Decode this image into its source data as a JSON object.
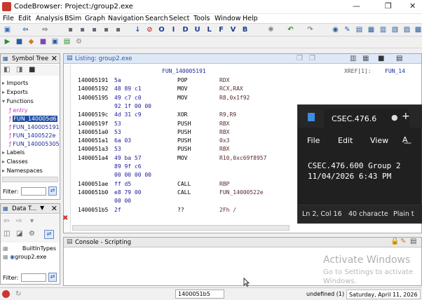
{
  "window": {
    "title": "CodeBrowser: Project:/group2.exe"
  },
  "menubar": [
    "File",
    "Edit",
    "Analysis",
    "BSim",
    "Graph",
    "Navigation",
    "Search",
    "Select",
    "Tools",
    "Window",
    "Help"
  ],
  "symbol_tree": {
    "title": "Symbol Tree",
    "items": [
      "Imports",
      "Exports",
      "Functions",
      "entry",
      "FUN_140005d6",
      "FUN_140005191",
      "FUN_1400522e",
      "FUN_140005305",
      "Labels",
      "Classes",
      "Namespaces"
    ],
    "filter_label": "Filter:"
  },
  "data_types": {
    "title": "Data T...",
    "items": [
      "BuiltInTypes",
      "group2.exe"
    ],
    "filter_label": "Filter:"
  },
  "listing": {
    "tab_title": "Listing:  group2.exe",
    "function_label": "FUN_140005191",
    "xref_label": "XREF[1]:",
    "xref_target": "FUN_14",
    "rows": [
      {
        "addr": "140005191",
        "bytes": "5a",
        "mnemonic": "POP",
        "operand": "RDX"
      },
      {
        "addr": "140005192",
        "bytes": "48 89 c1",
        "mnemonic": "MOV",
        "operand": "RCX,RAX"
      },
      {
        "addr": "140005195",
        "bytes": "49 c7 c0",
        "mnemonic": "MOV",
        "operand": "R8,0x1f92"
      },
      {
        "addr": "",
        "bytes": "92 1f 00 00",
        "mnemonic": "",
        "operand": ""
      },
      {
        "addr": "14000519c",
        "bytes": "4d 31 c9",
        "mnemonic": "XOR",
        "operand": "R9,R9"
      },
      {
        "addr": "14000519f",
        "bytes": "53",
        "mnemonic": "PUSH",
        "operand": "RBX"
      },
      {
        "addr": "1400051a0",
        "bytes": "53",
        "mnemonic": "PUSH",
        "operand": "RBX"
      },
      {
        "addr": "1400051a1",
        "bytes": "6a 03",
        "mnemonic": "PUSH",
        "operand": "0x3"
      },
      {
        "addr": "1400051a3",
        "bytes": "53",
        "mnemonic": "PUSH",
        "operand": "RBX"
      },
      {
        "addr": "1400051a4",
        "bytes": "49 ba 57",
        "mnemonic": "MOV",
        "operand": "R10,0xc69f8957"
      },
      {
        "addr": "",
        "bytes": "89 9f c6",
        "mnemonic": "",
        "operand": ""
      },
      {
        "addr": "",
        "bytes": "00 00 00 00",
        "mnemonic": "",
        "operand": ""
      },
      {
        "addr": "1400051ae",
        "bytes": "ff d5",
        "mnemonic": "CALL",
        "operand": "RBP"
      },
      {
        "addr": "1400051b0",
        "bytes": "e8 79 00",
        "mnemonic": "CALL",
        "operand": "FUN_14000522e"
      },
      {
        "addr": "",
        "bytes": "00 00",
        "mnemonic": "",
        "operand": ""
      },
      {
        "addr": "1400051b5",
        "bytes": "2f",
        "mnemonic": "??",
        "operand": "2Fh    /"
      }
    ]
  },
  "console": {
    "title": "Console - Scripting"
  },
  "watermark": {
    "line1": "Activate Windows",
    "line2": "Go to Settings to activate",
    "line3": "Windows."
  },
  "statusbar": {
    "address": "1400051b5",
    "undefined": "undefined  (1)",
    "date": "Saturday, April 11, 2026"
  },
  "notepad": {
    "tab_title": "CSEC.476.6",
    "menu": [
      "File",
      "Edit",
      "View"
    ],
    "line1": "CSEC.476.600 Group 2",
    "line2": "11/04/2026 6:43 PM",
    "status": [
      "Ln 2, Col 16",
      "40 characte",
      "Plain t"
    ]
  }
}
